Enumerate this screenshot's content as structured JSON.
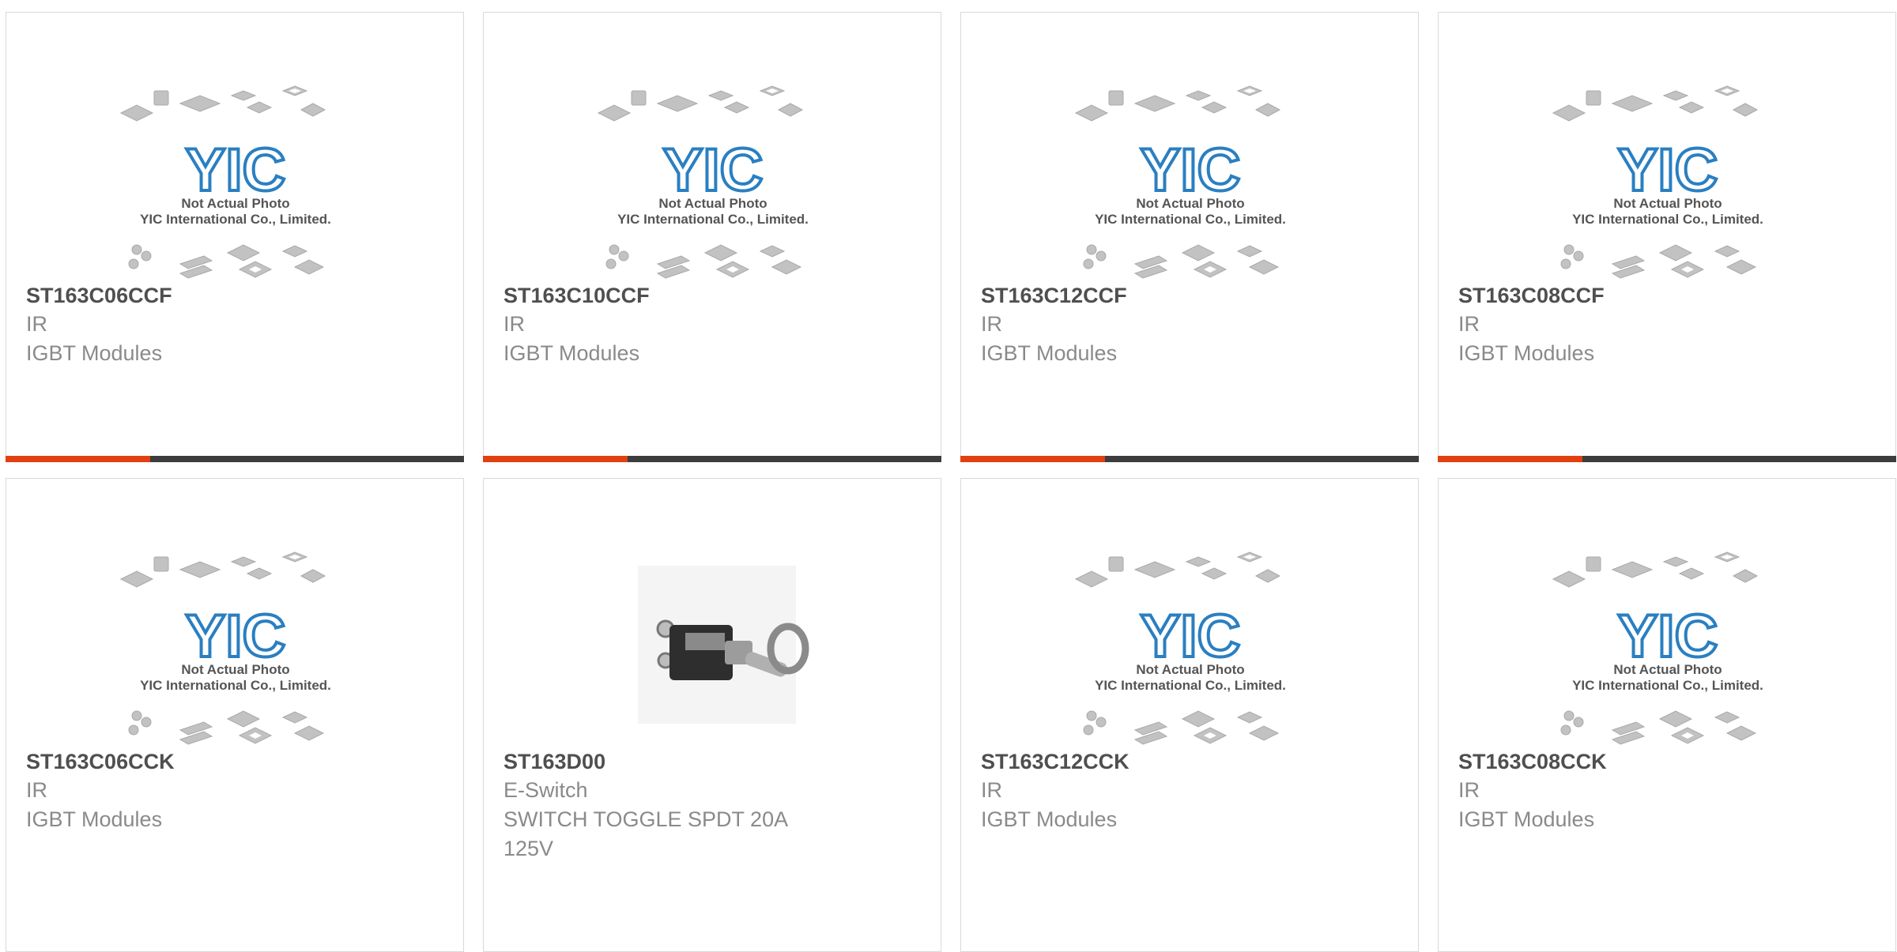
{
  "placeholder": {
    "brand": "YIC",
    "line1": "Not Actual Photo",
    "line2": "YIC International Co., Limited."
  },
  "colors": {
    "accent": "#e2400f",
    "bar": "#3d3d3d",
    "logo": "#2a7fc1"
  },
  "products": [
    {
      "part": "ST163C06CCF",
      "maker": "IR",
      "desc": "IGBT Modules",
      "image": "yic-placeholder",
      "progress_accent": 0.31
    },
    {
      "part": "ST163C10CCF",
      "maker": "IR",
      "desc": "IGBT Modules",
      "image": "yic-placeholder",
      "progress_accent": 0.31
    },
    {
      "part": "ST163C12CCF",
      "maker": "IR",
      "desc": "IGBT Modules",
      "image": "yic-placeholder",
      "progress_accent": 0.31
    },
    {
      "part": "ST163C08CCF",
      "maker": "IR",
      "desc": "IGBT Modules",
      "image": "yic-placeholder",
      "progress_accent": 0.31
    },
    {
      "part": "ST163C06CCK",
      "maker": "IR",
      "desc": "IGBT Modules",
      "image": "yic-placeholder"
    },
    {
      "part": "ST163D00",
      "maker": "E-Switch",
      "desc": "SWITCH TOGGLE SPDT 20A 125V",
      "image": "toggle-switch-photo"
    },
    {
      "part": "ST163C12CCK",
      "maker": "IR",
      "desc": "IGBT Modules",
      "image": "yic-placeholder"
    },
    {
      "part": "ST163C08CCK",
      "maker": "IR",
      "desc": "IGBT Modules",
      "image": "yic-placeholder"
    }
  ]
}
